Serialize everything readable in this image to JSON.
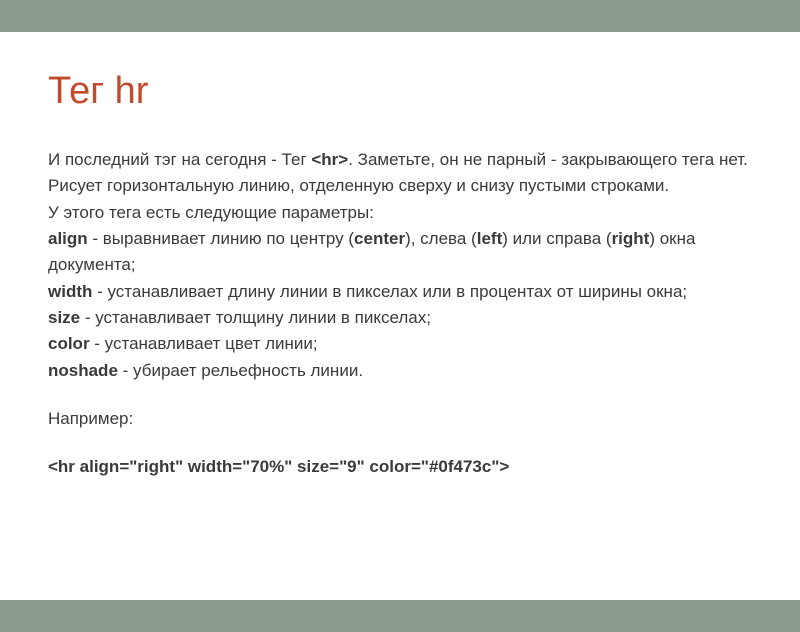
{
  "title": "Тег hr",
  "p1a": "И последний тэг на сегодня - Тег ",
  "p1b": "<hr>",
  "p1c": ". Заметьте, он не парный - закрывающего тега нет.",
  "p2": "Рисует горизонтальную линию, отделенную сверху и снизу пустыми строками.",
  "p3": "У этого тега есть следующие параметры:",
  "align_label": "align",
  "align_t1": " - выравнивает линию по центру (",
  "align_center": "center",
  "align_t2": "), слева (",
  "align_left": "left",
  "align_t3": ") или справа (",
  "align_right": "right",
  "align_t4": ") окна документа;",
  "width_label": "width",
  "width_text": " - устанавливает длину линии в пикселах или в процентах от ширины окна;",
  "size_label": "size",
  "size_text": " - устанавливает толщину линии в пикселах;",
  "color_label": "color",
  "color_text": " - устанавливает цвет линии;",
  "noshade_label": "noshade",
  "noshade_text": " - убирает рельефность линии.",
  "example_label": "Например:",
  "example_code": "<hr align=\"right\" width=\"70%\" size=\"9\" color=\"#0f473c\">"
}
